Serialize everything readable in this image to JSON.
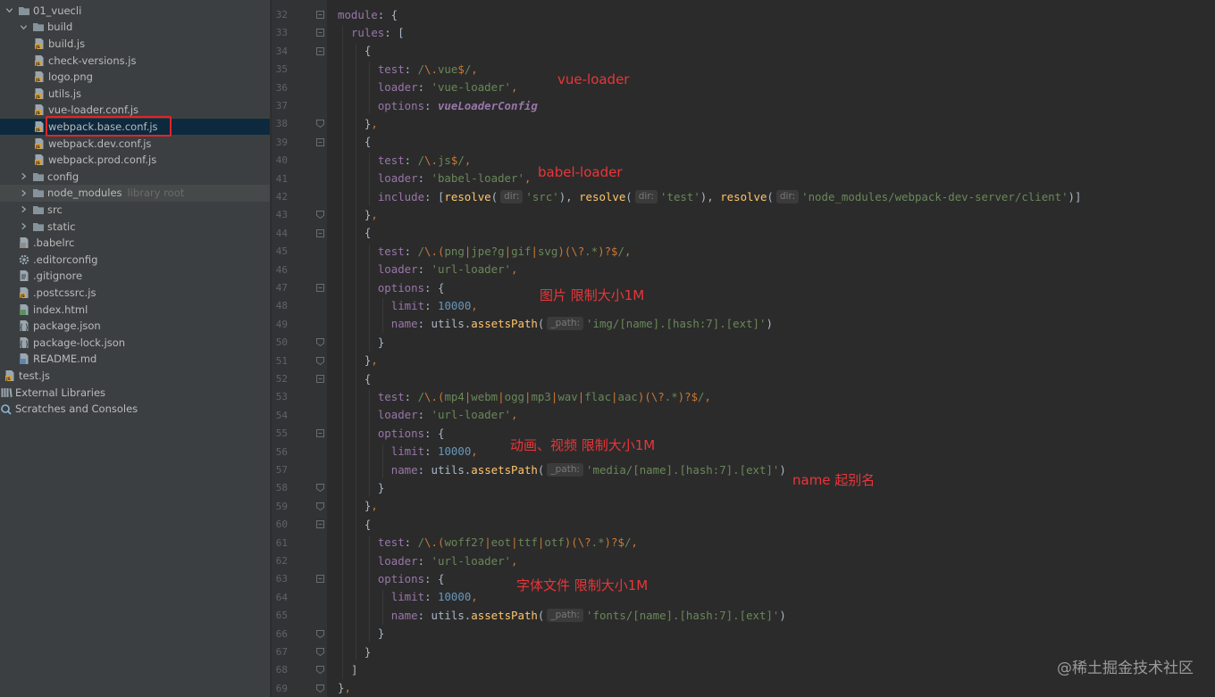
{
  "project_tree": {
    "nodes": [
      {
        "label": "01_vuecli",
        "hint": "",
        "arrow": "down",
        "icon": "folder-icon"
      },
      {
        "label": "build",
        "hint": "",
        "arrow": "down",
        "icon": "folder-icon"
      },
      {
        "label": "build.js",
        "hint": "",
        "arrow": "",
        "icon": "js-file-icon"
      },
      {
        "label": "check-versions.js",
        "hint": "",
        "arrow": "",
        "icon": "js-file-icon"
      },
      {
        "label": "logo.png",
        "hint": "",
        "arrow": "",
        "icon": "image-file-icon"
      },
      {
        "label": "utils.js",
        "hint": "",
        "arrow": "",
        "icon": "js-file-icon"
      },
      {
        "label": "vue-loader.conf.js",
        "hint": "",
        "arrow": "",
        "icon": "js-file-icon"
      },
      {
        "label": "webpack.base.conf.js",
        "hint": "",
        "arrow": "",
        "icon": "js-file-icon"
      },
      {
        "label": "webpack.dev.conf.js",
        "hint": "",
        "arrow": "",
        "icon": "js-file-icon"
      },
      {
        "label": "webpack.prod.conf.js",
        "hint": "",
        "arrow": "",
        "icon": "js-file-icon"
      },
      {
        "label": "config",
        "hint": "",
        "arrow": "right",
        "icon": "folder-icon"
      },
      {
        "label": "node_modules",
        "hint": "library root",
        "arrow": "right",
        "icon": "folder-icon"
      },
      {
        "label": "src",
        "hint": "",
        "arrow": "right",
        "icon": "folder-icon"
      },
      {
        "label": "static",
        "hint": "",
        "arrow": "right",
        "icon": "folder-icon"
      },
      {
        "label": ".babelrc",
        "hint": "",
        "arrow": "",
        "icon": "config-file-icon"
      },
      {
        "label": ".editorconfig",
        "hint": "",
        "arrow": "",
        "icon": "gear-icon"
      },
      {
        "label": ".gitignore",
        "hint": "",
        "arrow": "",
        "icon": "text-file-icon"
      },
      {
        "label": ".postcssrc.js",
        "hint": "",
        "arrow": "",
        "icon": "js-file-icon"
      },
      {
        "label": "index.html",
        "hint": "",
        "arrow": "",
        "icon": "html-file-icon"
      },
      {
        "label": "package.json",
        "hint": "",
        "arrow": "",
        "icon": "json-file-icon"
      },
      {
        "label": "package-lock.json",
        "hint": "",
        "arrow": "",
        "icon": "json-file-icon"
      },
      {
        "label": "README.md",
        "hint": "",
        "arrow": "",
        "icon": "markdown-file-icon"
      },
      {
        "label": "test.js",
        "hint": "",
        "arrow": "",
        "icon": "js-file-icon"
      },
      {
        "label": "External Libraries",
        "hint": "",
        "arrow": "",
        "icon": "library-icon"
      },
      {
        "label": "Scratches and Consoles",
        "hint": "",
        "arrow": "",
        "icon": "scratches-icon"
      }
    ],
    "selected": "webpack.base.conf.js"
  },
  "editor": {
    "lines": [
      {
        "n": "32",
        "tokens": [
          [
            "module",
            "k-prop"
          ],
          [
            ": {",
            "k-plain"
          ]
        ]
      },
      {
        "n": "33",
        "tokens": [
          [
            "rules",
            "k-prop"
          ],
          [
            ": [",
            "k-plain"
          ]
        ]
      },
      {
        "n": "34",
        "tokens": [
          [
            "{",
            "k-plain"
          ]
        ]
      },
      {
        "n": "35",
        "tokens": [
          [
            "test",
            "k-prop"
          ],
          [
            ": ",
            "k-plain"
          ],
          [
            "/",
            "k-regex"
          ],
          [
            "\\.",
            "k-rx-esc"
          ],
          [
            "vue",
            "k-regex"
          ],
          [
            "$",
            "k-rx-esc"
          ],
          [
            "/",
            "k-regex"
          ],
          [
            ",",
            "k-comma"
          ]
        ]
      },
      {
        "n": "36",
        "tokens": [
          [
            "loader",
            "k-prop"
          ],
          [
            ": ",
            "k-plain"
          ],
          [
            "'vue-loader'",
            "k-str"
          ],
          [
            ",",
            "k-comma"
          ]
        ]
      },
      {
        "n": "37",
        "tokens": [
          [
            "options",
            "k-prop"
          ],
          [
            ": ",
            "k-plain"
          ],
          [
            "vueLoaderConfig",
            "k-var"
          ]
        ]
      },
      {
        "n": "38",
        "tokens": [
          [
            "}",
            "k-plain"
          ],
          [
            ",",
            "k-comma"
          ]
        ]
      },
      {
        "n": "39",
        "tokens": [
          [
            "{",
            "k-plain"
          ]
        ]
      },
      {
        "n": "40",
        "tokens": [
          [
            "test",
            "k-prop"
          ],
          [
            ": ",
            "k-plain"
          ],
          [
            "/",
            "k-regex"
          ],
          [
            "\\.",
            "k-rx-esc"
          ],
          [
            "js",
            "k-regex"
          ],
          [
            "$",
            "k-rx-esc"
          ],
          [
            "/",
            "k-regex"
          ],
          [
            ",",
            "k-comma"
          ]
        ]
      },
      {
        "n": "41",
        "tokens": [
          [
            "loader",
            "k-prop"
          ],
          [
            ": ",
            "k-plain"
          ],
          [
            "'babel-loader'",
            "k-str"
          ],
          [
            ",",
            "k-comma"
          ]
        ]
      },
      {
        "n": "42",
        "tokens": [
          [
            "include",
            "k-prop"
          ],
          [
            ": [",
            "k-plain"
          ],
          [
            "resolve",
            "k-fn"
          ],
          [
            "(",
            "k-plain"
          ],
          [
            "dir:",
            "hint"
          ],
          [
            "'src'",
            "k-str"
          ],
          [
            "), ",
            "k-plain"
          ],
          [
            "resolve",
            "k-fn"
          ],
          [
            "(",
            "k-plain"
          ],
          [
            "dir:",
            "hint"
          ],
          [
            "'test'",
            "k-str"
          ],
          [
            "), ",
            "k-plain"
          ],
          [
            "resolve",
            "k-fn"
          ],
          [
            "(",
            "k-plain"
          ],
          [
            "dir:",
            "hint"
          ],
          [
            "'node_modules/webpack-dev-server/client'",
            "k-str"
          ],
          [
            ")]",
            "k-plain"
          ]
        ]
      },
      {
        "n": "43",
        "tokens": [
          [
            "}",
            "k-plain"
          ],
          [
            ",",
            "k-comma"
          ]
        ]
      },
      {
        "n": "44",
        "tokens": [
          [
            "{",
            "k-plain"
          ]
        ]
      },
      {
        "n": "45",
        "tokens": [
          [
            "test",
            "k-prop"
          ],
          [
            ": ",
            "k-plain"
          ],
          [
            "/",
            "k-regex"
          ],
          [
            "\\.",
            "k-rx-esc"
          ],
          [
            "(",
            "k-rx-brk"
          ],
          [
            "png",
            "k-regex"
          ],
          [
            "|",
            "k-rx-alt"
          ],
          [
            "jpe?g",
            "k-regex"
          ],
          [
            "|",
            "k-rx-alt"
          ],
          [
            "gif",
            "k-regex"
          ],
          [
            "|",
            "k-rx-alt"
          ],
          [
            "svg",
            "k-regex"
          ],
          [
            ")(",
            "k-rx-brk"
          ],
          [
            "\\?",
            "k-rx-esc"
          ],
          [
            ".*",
            "k-regex"
          ],
          [
            ")",
            "k-rx-brk"
          ],
          [
            "?$",
            "k-rx-esc"
          ],
          [
            "/",
            "k-regex"
          ],
          [
            ",",
            "k-comma"
          ]
        ]
      },
      {
        "n": "46",
        "tokens": [
          [
            "loader",
            "k-prop"
          ],
          [
            ": ",
            "k-plain"
          ],
          [
            "'url-loader'",
            "k-str"
          ],
          [
            ",",
            "k-comma"
          ]
        ]
      },
      {
        "n": "47",
        "tokens": [
          [
            "options",
            "k-prop"
          ],
          [
            ": {",
            "k-plain"
          ]
        ]
      },
      {
        "n": "48",
        "tokens": [
          [
            "limit",
            "k-prop"
          ],
          [
            ": ",
            "k-plain"
          ],
          [
            "10000",
            "k-num"
          ],
          [
            ",",
            "k-comma"
          ]
        ]
      },
      {
        "n": "49",
        "tokens": [
          [
            "name",
            "k-prop"
          ],
          [
            ": utils.",
            "k-plain"
          ],
          [
            "assetsPath",
            "k-fn"
          ],
          [
            "(",
            "k-plain"
          ],
          [
            "_path:",
            "hint"
          ],
          [
            "'img/[name].[hash:7].[ext]'",
            "k-str"
          ],
          [
            ")",
            "k-plain"
          ]
        ]
      },
      {
        "n": "50",
        "tokens": [
          [
            "}",
            "k-plain"
          ]
        ]
      },
      {
        "n": "51",
        "tokens": [
          [
            "}",
            "k-plain"
          ],
          [
            ",",
            "k-comma"
          ]
        ]
      },
      {
        "n": "52",
        "tokens": [
          [
            "{",
            "k-plain"
          ]
        ]
      },
      {
        "n": "53",
        "tokens": [
          [
            "test",
            "k-prop"
          ],
          [
            ": ",
            "k-plain"
          ],
          [
            "/",
            "k-regex"
          ],
          [
            "\\.",
            "k-rx-esc"
          ],
          [
            "(",
            "k-rx-brk"
          ],
          [
            "mp4",
            "k-regex"
          ],
          [
            "|",
            "k-rx-alt"
          ],
          [
            "webm",
            "k-regex"
          ],
          [
            "|",
            "k-rx-alt"
          ],
          [
            "ogg",
            "k-regex"
          ],
          [
            "|",
            "k-rx-alt"
          ],
          [
            "mp3",
            "k-regex"
          ],
          [
            "|",
            "k-rx-alt"
          ],
          [
            "wav",
            "k-regex"
          ],
          [
            "|",
            "k-rx-alt"
          ],
          [
            "flac",
            "k-regex"
          ],
          [
            "|",
            "k-rx-alt"
          ],
          [
            "aac",
            "k-regex"
          ],
          [
            ")(",
            "k-rx-brk"
          ],
          [
            "\\?",
            "k-rx-esc"
          ],
          [
            ".*",
            "k-regex"
          ],
          [
            ")",
            "k-rx-brk"
          ],
          [
            "?$",
            "k-rx-esc"
          ],
          [
            "/",
            "k-regex"
          ],
          [
            ",",
            "k-comma"
          ]
        ]
      },
      {
        "n": "54",
        "tokens": [
          [
            "loader",
            "k-prop"
          ],
          [
            ": ",
            "k-plain"
          ],
          [
            "'url-loader'",
            "k-str"
          ],
          [
            ",",
            "k-comma"
          ]
        ]
      },
      {
        "n": "55",
        "tokens": [
          [
            "options",
            "k-prop"
          ],
          [
            ": {",
            "k-plain"
          ]
        ]
      },
      {
        "n": "56",
        "tokens": [
          [
            "limit",
            "k-prop"
          ],
          [
            ": ",
            "k-plain"
          ],
          [
            "10000",
            "k-num"
          ],
          [
            ",",
            "k-comma"
          ]
        ]
      },
      {
        "n": "57",
        "tokens": [
          [
            "name",
            "k-prop"
          ],
          [
            ": utils.",
            "k-plain"
          ],
          [
            "assetsPath",
            "k-fn"
          ],
          [
            "(",
            "k-plain"
          ],
          [
            "_path:",
            "hint"
          ],
          [
            "'media/[name].[hash:7].[ext]'",
            "k-str"
          ],
          [
            ")",
            "k-plain"
          ]
        ]
      },
      {
        "n": "58",
        "tokens": [
          [
            "}",
            "k-plain"
          ]
        ]
      },
      {
        "n": "59",
        "tokens": [
          [
            "}",
            "k-plain"
          ],
          [
            ",",
            "k-comma"
          ]
        ]
      },
      {
        "n": "60",
        "tokens": [
          [
            "{",
            "k-plain"
          ]
        ]
      },
      {
        "n": "61",
        "tokens": [
          [
            "test",
            "k-prop"
          ],
          [
            ": ",
            "k-plain"
          ],
          [
            "/",
            "k-regex"
          ],
          [
            "\\.",
            "k-rx-esc"
          ],
          [
            "(",
            "k-rx-brk"
          ],
          [
            "woff2?",
            "k-regex"
          ],
          [
            "|",
            "k-rx-alt"
          ],
          [
            "eot",
            "k-regex"
          ],
          [
            "|",
            "k-rx-alt"
          ],
          [
            "ttf",
            "k-regex"
          ],
          [
            "|",
            "k-rx-alt"
          ],
          [
            "otf",
            "k-regex"
          ],
          [
            ")(",
            "k-rx-brk"
          ],
          [
            "\\?",
            "k-rx-esc"
          ],
          [
            ".*",
            "k-regex"
          ],
          [
            ")",
            "k-rx-brk"
          ],
          [
            "?$",
            "k-rx-esc"
          ],
          [
            "/",
            "k-regex"
          ],
          [
            ",",
            "k-comma"
          ]
        ]
      },
      {
        "n": "62",
        "tokens": [
          [
            "loader",
            "k-prop"
          ],
          [
            ": ",
            "k-plain"
          ],
          [
            "'url-loader'",
            "k-str"
          ],
          [
            ",",
            "k-comma"
          ]
        ]
      },
      {
        "n": "63",
        "tokens": [
          [
            "options",
            "k-prop"
          ],
          [
            ": {",
            "k-plain"
          ]
        ]
      },
      {
        "n": "64",
        "tokens": [
          [
            "limit",
            "k-prop"
          ],
          [
            ": ",
            "k-plain"
          ],
          [
            "10000",
            "k-num"
          ],
          [
            ",",
            "k-comma"
          ]
        ]
      },
      {
        "n": "65",
        "tokens": [
          [
            "name",
            "k-prop"
          ],
          [
            ": utils.",
            "k-plain"
          ],
          [
            "assetsPath",
            "k-fn"
          ],
          [
            "(",
            "k-plain"
          ],
          [
            "_path:",
            "hint"
          ],
          [
            "'fonts/[name].[hash:7].[ext]'",
            "k-str"
          ],
          [
            ")",
            "k-plain"
          ]
        ]
      },
      {
        "n": "66",
        "tokens": [
          [
            "}",
            "k-plain"
          ]
        ]
      },
      {
        "n": "67",
        "tokens": [
          [
            "}",
            "k-plain"
          ]
        ]
      },
      {
        "n": "68",
        "tokens": [
          [
            "]",
            "k-plain"
          ]
        ]
      },
      {
        "n": "69",
        "tokens": [
          [
            "}",
            "k-plain"
          ],
          [
            ",",
            "k-comma"
          ]
        ]
      }
    ]
  },
  "annotations": {
    "vue_loader": "vue-loader",
    "babel_loader": "babel-loader",
    "image_limit": "图片 限制大小1M",
    "media_limit": "动画、视频 限制大小1M",
    "name_alias": "name 起别名",
    "font_limit": "字体文件 限制大小1M"
  },
  "watermark": "@稀土掘金技术社区",
  "colors": {
    "annotation_red": "#e8363a",
    "selection_bg": "#0d293e",
    "red_box": "#e0252a"
  }
}
